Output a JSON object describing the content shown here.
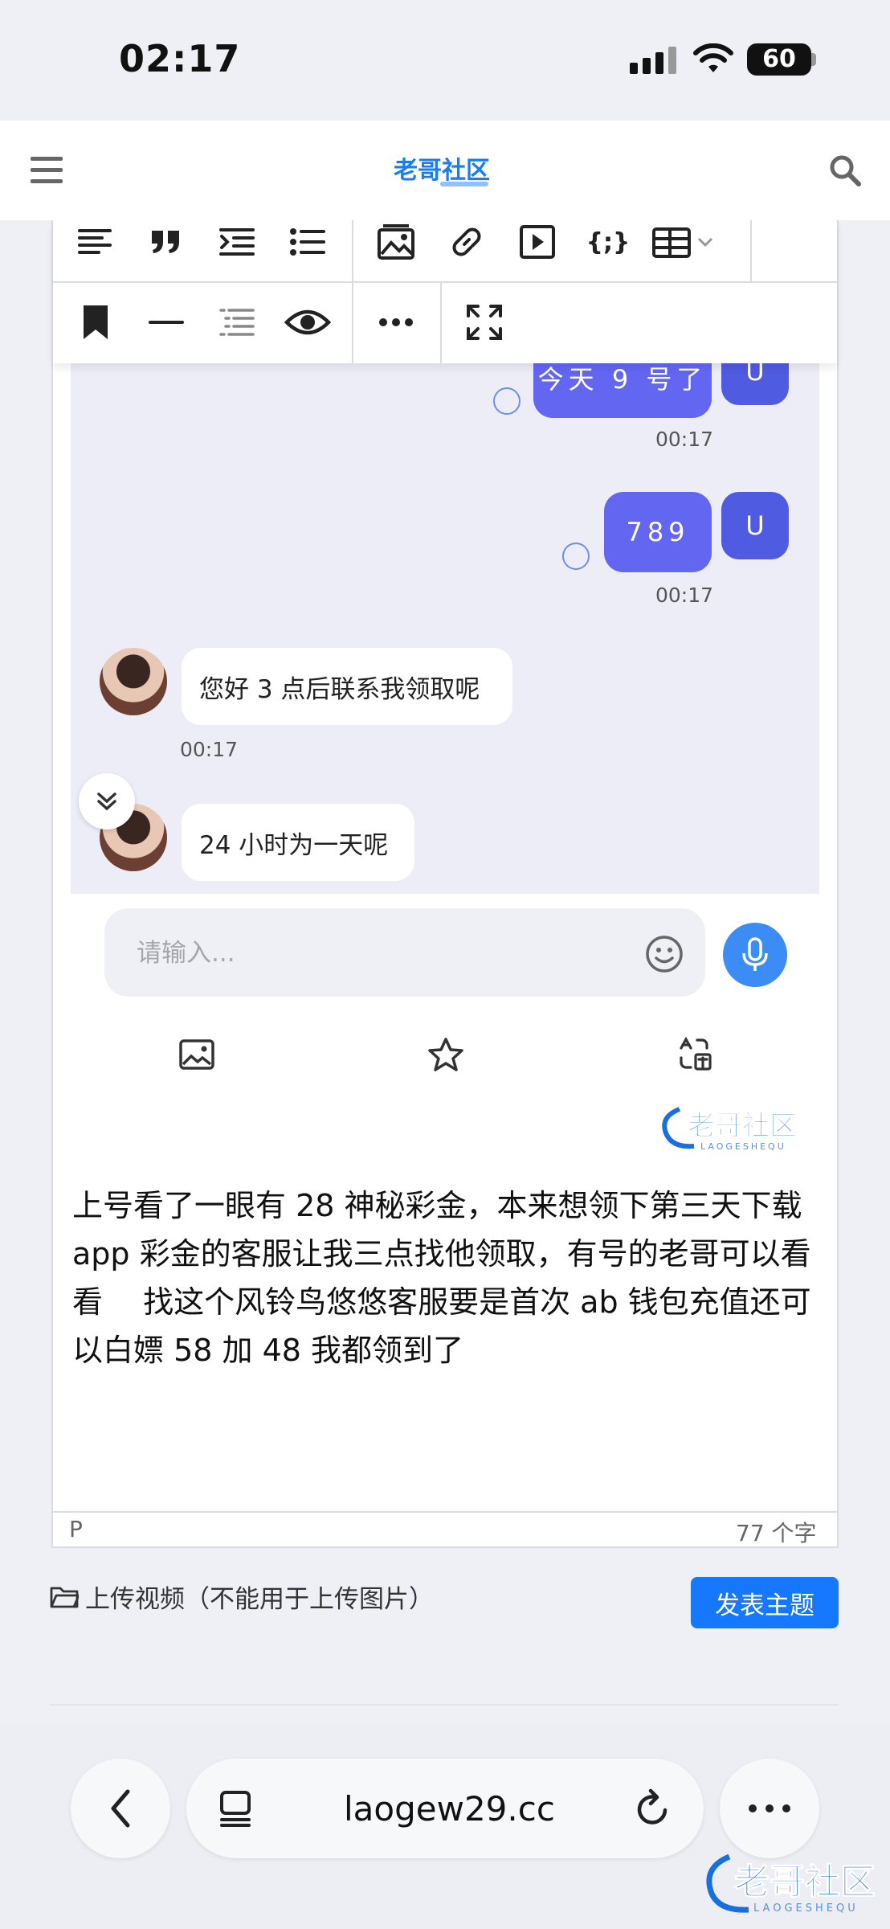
{
  "status": {
    "time": "02:17",
    "battery": "60"
  },
  "header": {
    "logo": "老哥社区"
  },
  "chat": {
    "messages": [
      {
        "text": "今天 9 号了",
        "avatar": "U",
        "time": "00:17"
      },
      {
        "text": "789",
        "avatar": "U",
        "time": "00:17"
      },
      {
        "text": "您好 3 点后联系我领取呢",
        "time": "00:17"
      },
      {
        "text": "24 小时为一天呢"
      }
    ],
    "input_placeholder": "请输入..."
  },
  "watermark": {
    "text": "老哥社区",
    "sub": "LAOGESHEQU"
  },
  "post": {
    "body": "上号看了一眼有 28 神秘彩金，本来想领下第三天下载 app 彩金的客服让我三点找他领取，有号的老哥可以看看　 找这个风铃鸟悠悠客服要是首次 ab 钱包充值还可以白嫖 58 加 48 我都领到了"
  },
  "editor_footer": {
    "tag": "P",
    "count": "77 个字"
  },
  "upload_label": "上传视频（不能用于上传图片）",
  "publish_label": "发表主题",
  "browser": {
    "url": "laogew29.cc"
  },
  "colors": {
    "accent": "#1677ff",
    "sent_bubble": "#6366f1",
    "mic": "#3b8cf5"
  }
}
